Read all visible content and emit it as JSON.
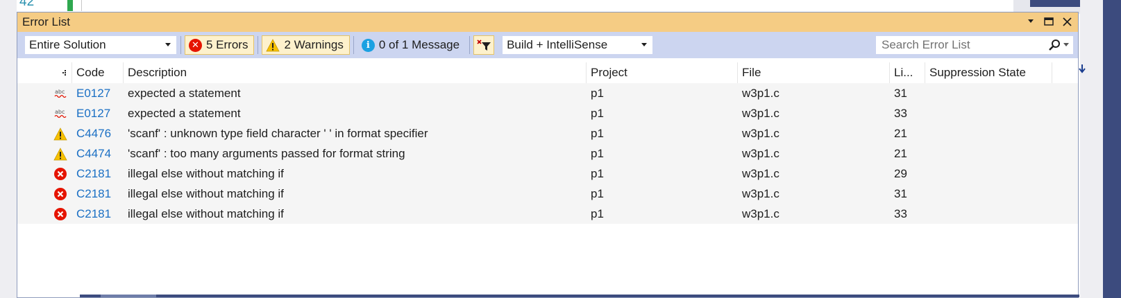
{
  "background": {
    "line_number": "42"
  },
  "window": {
    "title": "Error List",
    "controls": {
      "dropdown": "▾",
      "maximize": "☐",
      "close": "✕"
    }
  },
  "toolbar": {
    "scope_combo": "Entire Solution",
    "errors_label": "5 Errors",
    "warnings_label": "2 Warnings",
    "messages_label": "0 of 1 Message",
    "build_combo": "Build + IntelliSense",
    "search_placeholder": "Search Error List"
  },
  "columns": {
    "code": "Code",
    "description": "Description",
    "project": "Project",
    "file": "File",
    "line": "Li...",
    "suppression": "Suppression State"
  },
  "rows": [
    {
      "type": "intellisense",
      "icon": "spelling-squiggle-icon",
      "code": "E0127",
      "description": "expected a statement",
      "project": "p1",
      "file": "w3p1.c",
      "line": "31"
    },
    {
      "type": "intellisense",
      "icon": "spelling-squiggle-icon",
      "code": "E0127",
      "description": "expected a statement",
      "project": "p1",
      "file": "w3p1.c",
      "line": "33"
    },
    {
      "type": "warning",
      "icon": "warning-icon",
      "code": "C4476",
      "description": "'scanf' : unknown type field character ' ' in format specifier",
      "project": "p1",
      "file": "w3p1.c",
      "line": "21"
    },
    {
      "type": "warning",
      "icon": "warning-icon",
      "code": "C4474",
      "description": "'scanf' : too many arguments passed for format string",
      "project": "p1",
      "file": "w3p1.c",
      "line": "21"
    },
    {
      "type": "error",
      "icon": "error-icon",
      "code": "C2181",
      "description": "illegal else without matching if",
      "project": "p1",
      "file": "w3p1.c",
      "line": "29"
    },
    {
      "type": "error",
      "icon": "error-icon",
      "code": "C2181",
      "description": "illegal else without matching if",
      "project": "p1",
      "file": "w3p1.c",
      "line": "31"
    },
    {
      "type": "error",
      "icon": "error-icon",
      "code": "C2181",
      "description": "illegal else without matching if",
      "project": "p1",
      "file": "w3p1.c",
      "line": "33"
    }
  ],
  "colors": {
    "title_bar": "#f5cc84",
    "toolbar": "#ccd5f0",
    "code_link": "#1a6fc4",
    "error": "#e51400",
    "warning": "#f6c000",
    "info": "#1ba1e2"
  }
}
